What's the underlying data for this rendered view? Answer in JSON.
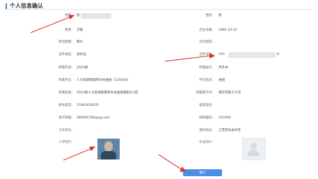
{
  "header": {
    "title": "个人信息确认"
  },
  "left": [
    {
      "label": "姓名:",
      "value": "张"
    },
    {
      "label": "民族:",
      "value": "汉族"
    },
    {
      "label": "政治面貌:",
      "value": "群众"
    },
    {
      "label": "证件类型:",
      "value": "身份证"
    },
    {
      "label": "所属年级:",
      "value": "2023春"
    },
    {
      "label": "所属专业:",
      "value": "人力资源管理专升本函授（120206）"
    },
    {
      "label": "所属班级:",
      "value": "2023春人力资源管理专升本函授南职大1班"
    },
    {
      "label": "移动电话:",
      "value": "15993428545"
    },
    {
      "label": "电子邮箱:",
      "value": "285905786@qq.com"
    },
    {
      "label": "工作单位:",
      "value": ""
    },
    {
      "label": "入学照片:",
      "value": ""
    }
  ],
  "right": [
    {
      "label": "性别:",
      "value": "男"
    },
    {
      "label": "出生日期:",
      "value": "1981-10-22"
    },
    {
      "label": "文化程度:",
      "value": ""
    },
    {
      "label": "证件号码:",
      "value": "150"
    },
    {
      "label": "所属层次:",
      "value": "专升本"
    },
    {
      "label": "学习形式:",
      "value": "函授"
    },
    {
      "label": "所属教学点:",
      "value": "南京市职工大学"
    },
    {
      "label": "家庭电话:",
      "value": ""
    },
    {
      "label": "邮政编码:",
      "value": "215000"
    },
    {
      "label": "通讯地址:",
      "value": "江苏苏州吴中区"
    },
    {
      "label": "毕业照片:",
      "value": ""
    }
  ],
  "id_suffix": "8",
  "confirm_button": "确认",
  "icons": {
    "student_photo": "student-photo",
    "placeholder_photo": "image-placeholder-icon"
  },
  "colors": {
    "accent": "#4c8de6",
    "arrow": "#d9352b"
  }
}
